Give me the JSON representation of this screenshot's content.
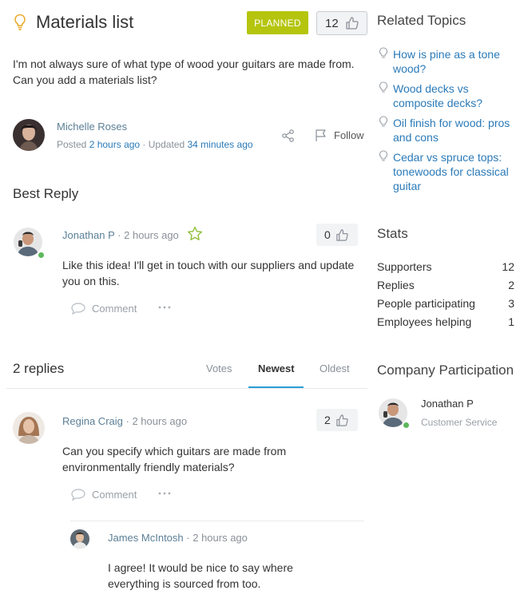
{
  "idea": {
    "title": "Materials list",
    "status": "PLANNED",
    "votes": "12",
    "description": "I'm not always sure of what type of wood your guitars are made from. Can you add a materials list?",
    "author": "Michelle Roses",
    "posted_label": "Posted",
    "posted_time": "2 hours ago",
    "updated_label": "Updated",
    "updated_time": "34 minutes ago",
    "follow_label": "Follow"
  },
  "best_reply": {
    "heading": "Best Reply",
    "author": "Jonathan P",
    "time": "2 hours ago",
    "votes": "0",
    "text": "Like this idea! I'll get in touch with our suppliers and update you on this.",
    "comment_label": "Comment"
  },
  "replies": {
    "heading": "2 replies",
    "tabs": [
      "Votes",
      "Newest",
      "Oldest"
    ],
    "active_tab": "Newest",
    "items": [
      {
        "author": "Regina Craig",
        "time": "2 hours ago",
        "votes": "2",
        "text": "Can you specify which guitars are made from environmentally friendly materials?",
        "comment_label": "Comment",
        "comments": [
          {
            "author": "James McIntosh",
            "time": "2 hours ago",
            "text": "I agree! It would be nice to say where everything is sourced from too."
          }
        ]
      }
    ]
  },
  "sidebar": {
    "related_heading": "Related Topics",
    "related": [
      "How is pine as a tone wood?",
      "Wood decks vs composite decks?",
      "Oil finish for wood: pros and cons",
      "Cedar vs spruce tops: tonewoods for classical guitar"
    ],
    "stats_heading": "Stats",
    "stats": [
      {
        "label": "Supporters",
        "value": "12"
      },
      {
        "label": "Replies",
        "value": "2"
      },
      {
        "label": "People participating",
        "value": "3"
      },
      {
        "label": "Employees helping",
        "value": "1"
      }
    ],
    "company_heading": "Company Participation",
    "company_member": {
      "name": "Jonathan P",
      "role": "Customer Service"
    }
  },
  "colors": {
    "planned": "#b5c50e",
    "link": "#2a7ab8",
    "online": "#5cb85c",
    "tab_underline": "#2a9fd6"
  },
  "icons": [
    "lightbulb-icon",
    "thumbs-up-icon",
    "share-icon",
    "flag-icon",
    "star-icon",
    "comment-icon",
    "more-icon"
  ]
}
